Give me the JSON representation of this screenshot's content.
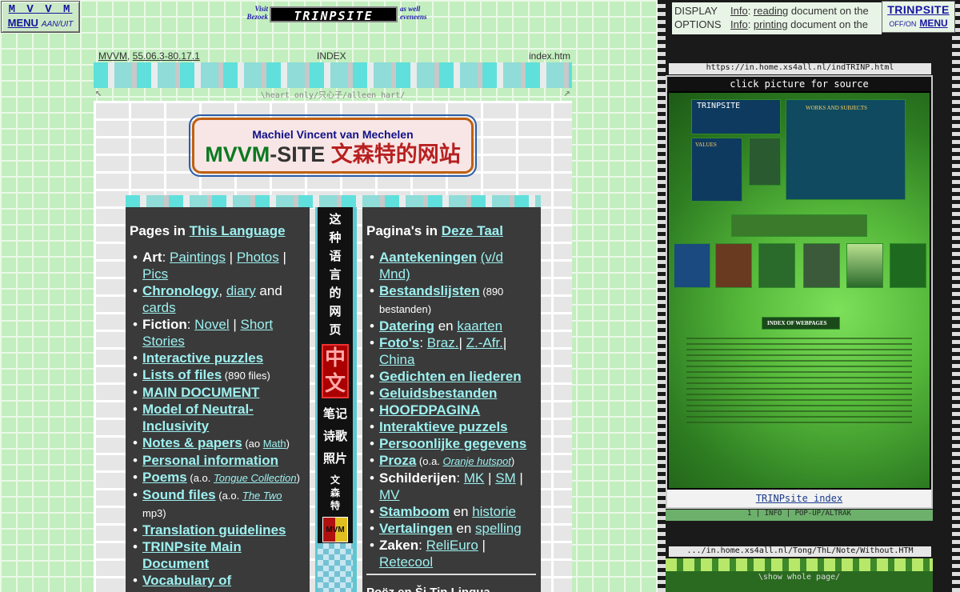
{
  "menu": {
    "title": "M V V M",
    "menu_label": "MENU",
    "toggle": "AAN/UIT"
  },
  "visit_banner": {
    "left_line1": "Visit",
    "left_line2": "Bezoek",
    "logo": "TRINPSITE",
    "right_line1": "as well",
    "right_line2": "eveneens"
  },
  "meta": {
    "left_link1": "MVVM",
    "left_sep": ", ",
    "left_link2": "55.06.3-80.17.1",
    "center": "INDEX",
    "right": "index.htm"
  },
  "heart_row": "\\heart only/只心子/alleen hart/",
  "site_title": {
    "author": "Machiel Vincent van Mechelen",
    "name_green": "MVVM",
    "name_dash": "-SITE",
    "name_chinese": "文森特的网站"
  },
  "left_panel": {
    "heading_prefix": "Pages in ",
    "heading_link": "This Language",
    "items": [
      {
        "parts": [
          [
            "w",
            "Art"
          ],
          [
            "t",
            ": "
          ],
          [
            "a",
            "Paintings"
          ],
          [
            "t",
            " | "
          ],
          [
            "a",
            "Photos"
          ],
          [
            "t",
            " | "
          ],
          [
            "a",
            "Pics"
          ]
        ]
      },
      {
        "parts": [
          [
            "ab",
            "Chronology"
          ],
          [
            "t",
            ", "
          ],
          [
            "a",
            "diary"
          ],
          [
            "t",
            " and "
          ],
          [
            "a",
            "cards"
          ]
        ]
      },
      {
        "parts": [
          [
            "w",
            "Fiction"
          ],
          [
            "t",
            ": "
          ],
          [
            "a",
            "Novel"
          ],
          [
            "t",
            " | "
          ],
          [
            "a",
            "Short Stories"
          ]
        ]
      },
      {
        "parts": [
          [
            "ab",
            "Interactive puzzles"
          ]
        ]
      },
      {
        "parts": [
          [
            "ab",
            "Lists of files"
          ],
          [
            "n",
            " (890 files)"
          ]
        ]
      },
      {
        "parts": [
          [
            "ab",
            "MAIN DOCUMENT"
          ]
        ]
      },
      {
        "parts": [
          [
            "ab",
            "Model of Neutral-Inclusivity"
          ]
        ]
      },
      {
        "parts": [
          [
            "ab",
            "Notes & papers"
          ],
          [
            "n",
            " (ao "
          ],
          [
            "an",
            "Math"
          ],
          [
            "n",
            ")"
          ]
        ]
      },
      {
        "parts": [
          [
            "ab",
            "Personal information"
          ]
        ]
      },
      {
        "parts": [
          [
            "ab",
            "Poems"
          ],
          [
            "n",
            " (a.o. "
          ],
          [
            "ai",
            "Tongue Collection"
          ],
          [
            "n",
            ")"
          ]
        ]
      },
      {
        "parts": [
          [
            "ab",
            "Sound files"
          ],
          [
            "n",
            " (a.o. "
          ],
          [
            "ai",
            "The Two"
          ],
          [
            "n",
            " mp3)"
          ]
        ]
      },
      {
        "parts": [
          [
            "ab",
            "Translation guidelines"
          ]
        ]
      },
      {
        "parts": [
          [
            "ab",
            "TRINPsite Main Document"
          ]
        ]
      },
      {
        "parts": [
          [
            "ab",
            "Vocabulary of"
          ]
        ]
      }
    ]
  },
  "middle": {
    "vertical_text": [
      "这",
      "种",
      "语",
      "言",
      "的",
      "网",
      "页"
    ],
    "big": [
      "中",
      "文"
    ],
    "words": [
      "笔记",
      "诗歌",
      "照片"
    ],
    "small": [
      "文",
      "森",
      "特"
    ],
    "logo": "MVM"
  },
  "right_panel": {
    "heading_prefix": "Pagina's in ",
    "heading_link": "Deze Taal",
    "items": [
      {
        "parts": [
          [
            "ab",
            "Aantekeningen"
          ],
          [
            "t",
            " "
          ],
          [
            "a",
            "(v/d Mnd)"
          ]
        ]
      },
      {
        "parts": [
          [
            "ab",
            "Bestandslijsten"
          ],
          [
            "n",
            " (890 bestanden)"
          ]
        ]
      },
      {
        "parts": [
          [
            "ab",
            "Datering"
          ],
          [
            "t",
            " en "
          ],
          [
            "a",
            "kaarten"
          ]
        ]
      },
      {
        "parts": [
          [
            "ab",
            "Foto's"
          ],
          [
            "t",
            ": "
          ],
          [
            "a",
            "Braz."
          ],
          [
            "t",
            "| "
          ],
          [
            "a",
            "Z.-Afr."
          ],
          [
            "t",
            "| "
          ],
          [
            "a",
            "China"
          ]
        ]
      },
      {
        "parts": [
          [
            "ab",
            "Gedichten en liederen"
          ]
        ]
      },
      {
        "parts": [
          [
            "ab",
            "Geluidsbestanden"
          ]
        ]
      },
      {
        "parts": [
          [
            "ab",
            "HOOFDPAGINA"
          ]
        ]
      },
      {
        "parts": [
          [
            "ab",
            "Interaktieve puzzels"
          ]
        ]
      },
      {
        "parts": [
          [
            "ab",
            "Persoonlijke gegevens"
          ]
        ]
      },
      {
        "parts": [
          [
            "ab",
            "Proza"
          ],
          [
            "n",
            " (o.a. "
          ],
          [
            "ai",
            "Oranje hutspot"
          ],
          [
            "n",
            ")"
          ]
        ]
      },
      {
        "parts": [
          [
            "w",
            "Schilderijen"
          ],
          [
            "t",
            ": "
          ],
          [
            "a",
            "MK"
          ],
          [
            "t",
            " | "
          ],
          [
            "a",
            "SM"
          ],
          [
            "t",
            " | "
          ],
          [
            "a",
            "MV"
          ]
        ]
      },
      {
        "parts": [
          [
            "ab",
            "Stamboom"
          ],
          [
            "t",
            " en "
          ],
          [
            "a",
            "historie"
          ]
        ]
      },
      {
        "parts": [
          [
            "ab",
            "Vertalingen"
          ],
          [
            "t",
            " en "
          ],
          [
            "a",
            "spelling"
          ]
        ]
      },
      {
        "parts": [
          [
            "w",
            "Zaken"
          ],
          [
            "t",
            ": "
          ],
          [
            "a",
            "ReliEuro"
          ],
          [
            "t",
            " | "
          ],
          [
            "a",
            "Retecool"
          ]
        ]
      }
    ],
    "after_separator": "Poëz en Ši Tin Lingua"
  },
  "display_options": {
    "label_line1": "DISPLAY",
    "label_line2": "OPTIONS",
    "row1_link": "Info",
    "row1_text": ": ",
    "row1_link2": "reading",
    "row1_tail": " document on the",
    "row2_link": "Info",
    "row2_text": ": ",
    "row2_link2": "printing",
    "row2_tail": " document on the"
  },
  "trinp_menu": {
    "title": "TRINPSITE",
    "toggle": "OFF/ON",
    "menu": "MENU"
  },
  "right_frame": {
    "url1": "https://in.home.xs4all.nl/indTRINP.html",
    "preview_caption": "click picture for source",
    "preview_footer": "TRINPsite index",
    "info_row": "1 | INFO | POP-UP/ALTRAK",
    "url2": ".../in.home.xs4all.nl/Tong/ThL/Note/Without.HTM",
    "preview2_text": "\\show whole page/"
  },
  "preview_labels": {
    "logo": "TRINPSITE",
    "works": "WORKS AND SUBJECTS",
    "values": "VALUES",
    "index": "INDEX OF WEBPAGES"
  },
  "colors": {
    "link": "#9ef0f0",
    "panel": "#3a3a3a",
    "accent_green": "#0b7a20",
    "chinese_red": "#b82020"
  }
}
